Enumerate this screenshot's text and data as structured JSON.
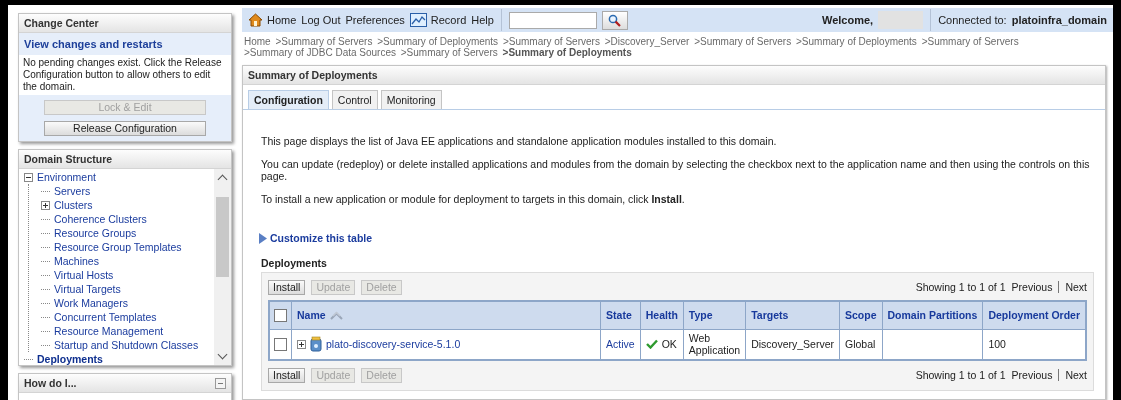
{
  "change_center": {
    "title": "Change Center",
    "link": "View changes and restarts",
    "message": "No pending changes exist. Click the Release Configuration button to allow others to edit the domain.",
    "buttons": [
      {
        "label": "Lock & Edit",
        "disabled": true
      },
      {
        "label": "Release Configuration",
        "disabled": false
      }
    ]
  },
  "domain_structure": {
    "title": "Domain Structure",
    "tree": [
      {
        "label": "Environment",
        "expanded": true,
        "selected": false,
        "children": [
          {
            "label": "Servers",
            "selected": false
          },
          {
            "label": "Clusters",
            "expanded": false,
            "selected": false
          },
          {
            "label": "Coherence Clusters",
            "selected": false
          },
          {
            "label": "Resource Groups",
            "selected": false
          },
          {
            "label": "Resource Group Templates",
            "selected": false
          },
          {
            "label": "Machines",
            "selected": false
          },
          {
            "label": "Virtual Hosts",
            "selected": false
          },
          {
            "label": "Virtual Targets",
            "selected": false
          },
          {
            "label": "Work Managers",
            "selected": false
          },
          {
            "label": "Concurrent Templates",
            "selected": false
          },
          {
            "label": "Resource Management",
            "selected": false
          },
          {
            "label": "Startup and Shutdown Classes",
            "selected": false
          }
        ]
      },
      {
        "label": "Deployments",
        "selected": true
      }
    ]
  },
  "how_do_i": {
    "title": "How do I..."
  },
  "top_bar": {
    "links": [
      {
        "label": "Home",
        "kind": "home"
      },
      {
        "label": "Log Out"
      },
      {
        "label": "Preferences"
      },
      {
        "label": "Record",
        "kind": "record"
      },
      {
        "label": "Help"
      }
    ],
    "welcome": "Welcome,",
    "connected_label": "Connected to:",
    "domain": "platoinfra_domain"
  },
  "breadcrumb": [
    {
      "label": "Home",
      "current": false
    },
    {
      "label": ">Summary of Servers",
      "current": false
    },
    {
      "label": ">Summary of Deployments",
      "current": false
    },
    {
      "label": ">Summary of Servers",
      "current": false
    },
    {
      "label": ">Discovery_Server",
      "current": false
    },
    {
      "label": ">Summary of Servers",
      "current": false
    },
    {
      "label": ">Summary of Deployments",
      "current": false
    },
    {
      "label": ">Summary of Servers",
      "current": false
    },
    {
      "label": ">Summary of JDBC Data Sources",
      "current": false
    },
    {
      "label": ">Summary of Servers",
      "current": false
    },
    {
      "label": ">Summary of Deployments",
      "current": true
    }
  ],
  "summary": {
    "title": "Summary of Deployments",
    "tabs": [
      {
        "label": "Configuration",
        "selected": true
      },
      {
        "label": "Control",
        "selected": false
      },
      {
        "label": "Monitoring",
        "selected": false
      }
    ],
    "paragraphs": [
      "This page displays the list of Java EE applications and standalone application modules installed to this domain.",
      "You can update (redeploy) or delete installed applications and modules from the domain by selecting the checkbox next to the application name and then using the controls on this page.",
      "To install a new application or module for deployment to targets in this domain, click **Install**."
    ],
    "customize_link": "Customize this table",
    "table_title": "Deployments",
    "toolbars": [
      {
        "buttons": [
          {
            "label": "Install",
            "disabled": false
          },
          {
            "label": "Update",
            "disabled": true
          },
          {
            "label": "Delete",
            "disabled": true
          }
        ],
        "showing": "Showing 1 to 1 of 1",
        "previous": "Previous",
        "next": "Next"
      },
      {
        "buttons": [
          {
            "label": "Install",
            "disabled": false
          },
          {
            "label": "Update",
            "disabled": true
          },
          {
            "label": "Delete",
            "disabled": true
          }
        ],
        "showing": "Showing 1 to 1 of 1",
        "previous": "Previous",
        "next": "Next"
      }
    ],
    "table": {
      "all_selected": false,
      "columns": [
        {
          "label": "Name",
          "sorted": true
        },
        {
          "label": "State",
          "sorted": false
        },
        {
          "label": "Health",
          "sorted": false
        },
        {
          "label": "Type",
          "sorted": false
        },
        {
          "label": "Targets",
          "sorted": false
        },
        {
          "label": "Scope",
          "sorted": false
        },
        {
          "label": "Domain Partitions",
          "sorted": false
        },
        {
          "label": "Deployment Order",
          "sorted": false
        }
      ],
      "rows": [
        {
          "checked": false,
          "expanded": false,
          "name": "plato-discovery-service-5.1.0",
          "state": "Active",
          "health": "OK",
          "type": "Web Application",
          "targets": "Discovery_Server",
          "scope": "Global",
          "deployment_order": "100"
        }
      ]
    }
  }
}
